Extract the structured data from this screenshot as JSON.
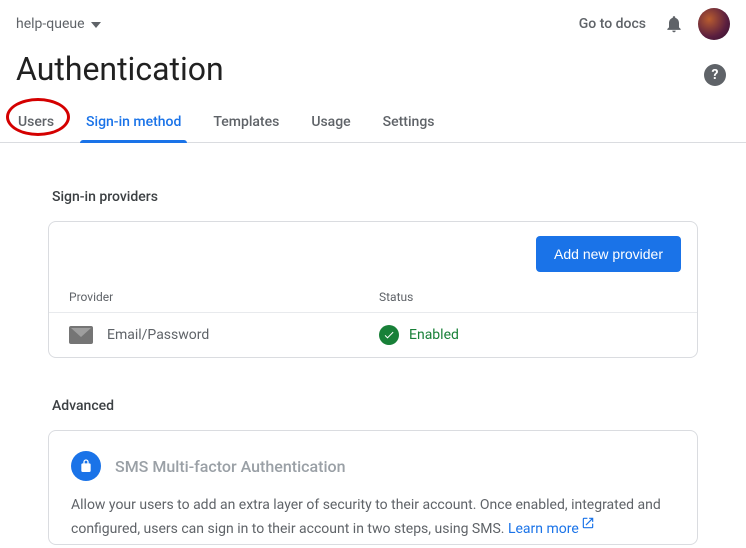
{
  "topbar": {
    "project_name": "help-queue",
    "docs_label": "Go to docs"
  },
  "page": {
    "title": "Authentication"
  },
  "tabs": [
    {
      "id": "users",
      "label": "Users",
      "active": false
    },
    {
      "id": "signin",
      "label": "Sign-in method",
      "active": true
    },
    {
      "id": "templates",
      "label": "Templates",
      "active": false
    },
    {
      "id": "usage",
      "label": "Usage",
      "active": false
    },
    {
      "id": "settings",
      "label": "Settings",
      "active": false
    }
  ],
  "signin": {
    "section_label": "Sign-in providers",
    "add_button": "Add new provider",
    "columns": {
      "provider": "Provider",
      "status": "Status"
    },
    "rows": [
      {
        "provider": "Email/Password",
        "status": "Enabled",
        "icon": "mail-icon"
      }
    ]
  },
  "advanced": {
    "section_label": "Advanced",
    "mfa_title": "SMS Multi-factor Authentication",
    "mfa_desc": "Allow your users to add an extra layer of security to their account. Once enabled, integrated and configured, users can sign in to their account in two steps, using SMS. ",
    "learn_more": "Learn more"
  },
  "annotation": {
    "circled_tab": "Users"
  }
}
